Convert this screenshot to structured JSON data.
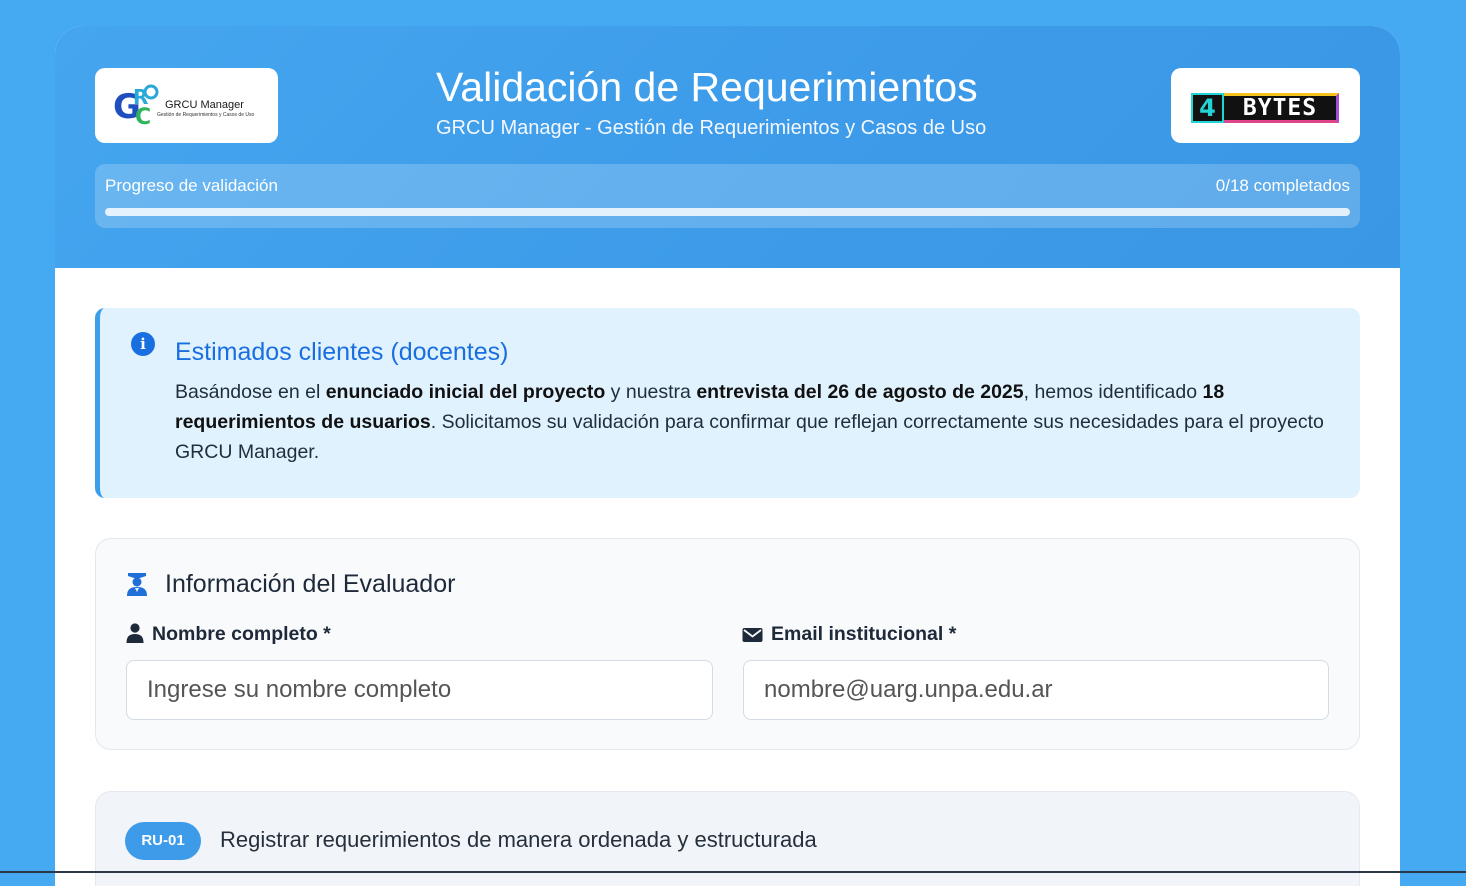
{
  "colors": {
    "page_background": "#45aaf2",
    "header_accent": "#3d9be9",
    "info_background": "#e0f2fe",
    "info_title": "#1a6fe0",
    "progress_fill": "#2ecc71"
  },
  "header": {
    "left_logo": {
      "name": "GRCU Manager",
      "tagline": "Gestión de Requerimientos y Casos de Uso"
    },
    "right_logo": {
      "digit": "4",
      "word": "BYTES"
    },
    "title": "Validación de Requerimientos",
    "subtitle": "GRCU Manager - Gestión de Requerimientos y Casos de Uso"
  },
  "progress": {
    "label": "Progreso de validación",
    "count_text": "0/18 completados",
    "completed": 0,
    "total": 18
  },
  "info": {
    "icon": "info-circle-icon",
    "title": "Estimados clientes (docentes)",
    "body": [
      {
        "text": "Basándose en el ",
        "bold": false
      },
      {
        "text": "enunciado inicial del proyecto",
        "bold": true
      },
      {
        "text": " y nuestra ",
        "bold": false
      },
      {
        "text": "entrevista del 26 de agosto de 2025",
        "bold": true
      },
      {
        "text": ", hemos identificado ",
        "bold": false
      },
      {
        "text": "18 requerimientos de usuarios",
        "bold": true
      },
      {
        "text": ". Solicitamos su validación para confirmar que reflejan correctamente sus necesidades para el proyecto GRCU Manager.",
        "bold": false
      }
    ]
  },
  "evaluator": {
    "icon": "graduate-icon",
    "title": "Información del Evaluador",
    "name_field": {
      "icon": "user-icon",
      "label": "Nombre completo *",
      "value": "",
      "placeholder": "Ingrese su nombre completo"
    },
    "email_field": {
      "icon": "envelope-icon",
      "label": "Email institucional *",
      "value": "",
      "placeholder": "nombre@uarg.unpa.edu.ar"
    }
  },
  "requirements": [
    {
      "code": "RU-01",
      "title": "Registrar requerimientos de manera ordenada y estructurada"
    }
  ]
}
